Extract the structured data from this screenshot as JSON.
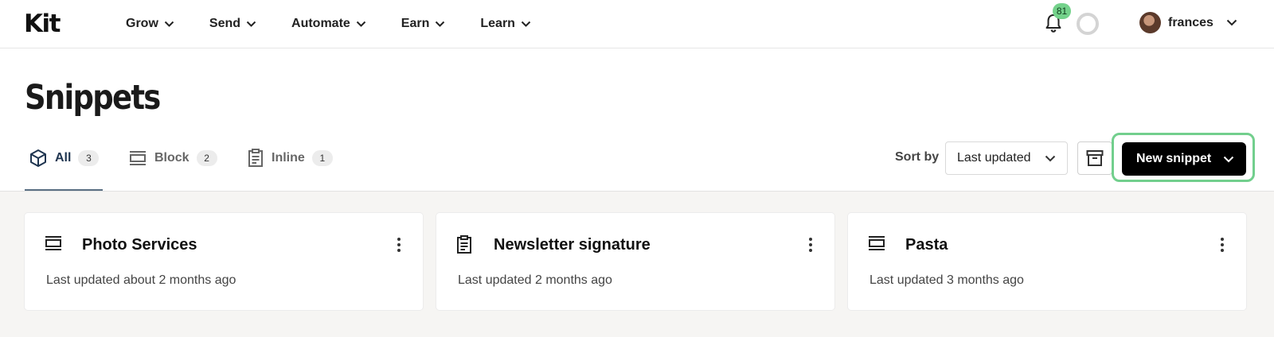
{
  "app": {
    "logo": "Kit"
  },
  "nav": {
    "items": [
      "Grow",
      "Send",
      "Automate",
      "Earn",
      "Learn"
    ]
  },
  "notifications": {
    "count": "81"
  },
  "user": {
    "name": "frances"
  },
  "page": {
    "title": "Snippets"
  },
  "tabs": [
    {
      "label": "All",
      "count": "3",
      "icon": "cube-icon",
      "active": true
    },
    {
      "label": "Block",
      "count": "2",
      "icon": "block-icon",
      "active": false
    },
    {
      "label": "Inline",
      "count": "1",
      "icon": "clipboard-icon",
      "active": false
    }
  ],
  "toolbar": {
    "sort_label": "Sort by",
    "sort_value": "Last updated",
    "new_button": "New snippet"
  },
  "cards": [
    {
      "title": "Photo Services",
      "subtitle": "Last updated about 2 months ago",
      "icon": "block-icon"
    },
    {
      "title": "Newsletter signature",
      "subtitle": "Last updated 2 months ago",
      "icon": "clipboard-icon"
    },
    {
      "title": "Pasta",
      "subtitle": "Last updated 3 months ago",
      "icon": "block-icon"
    }
  ],
  "colors": {
    "accent_green": "#72cf8d",
    "badge_green": "#74d28b",
    "primary_button": "#000000"
  }
}
